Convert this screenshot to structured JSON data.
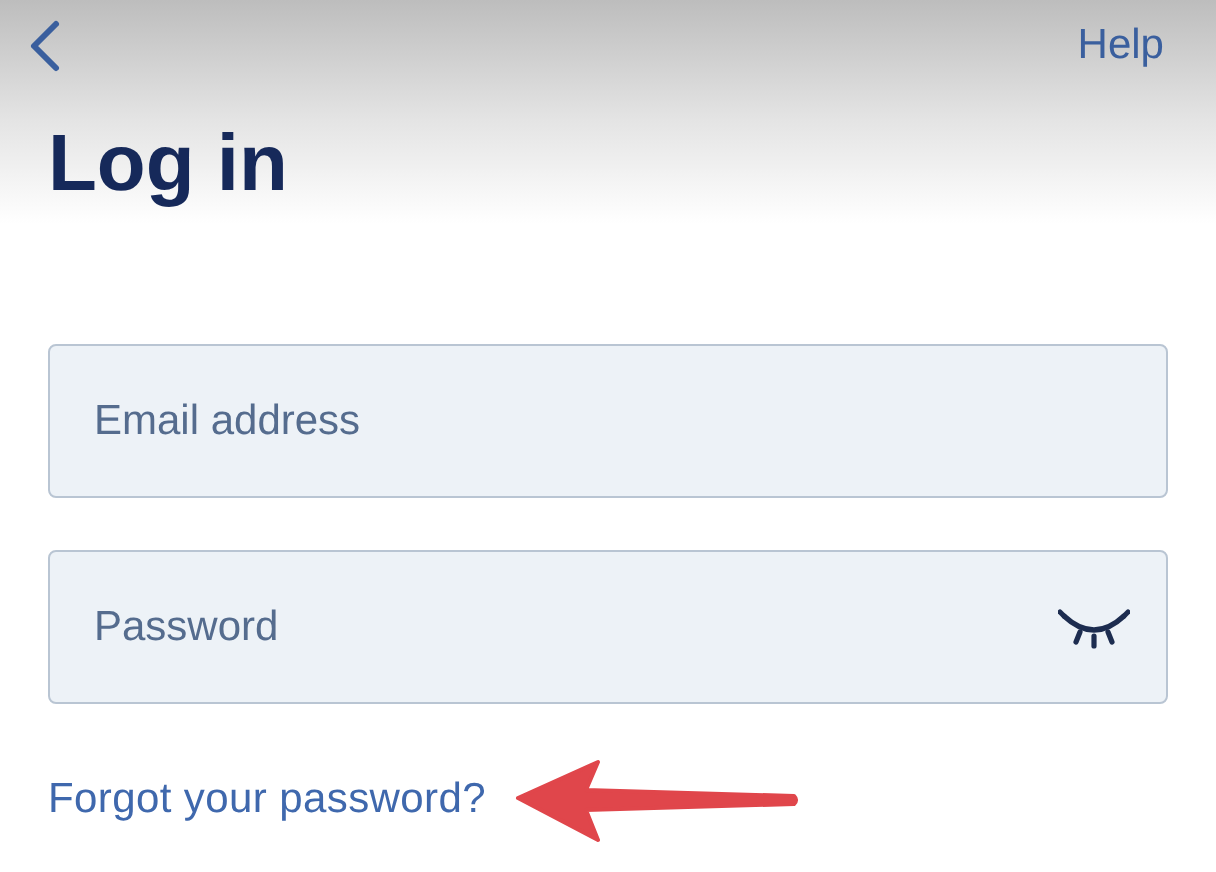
{
  "top_bar": {
    "help": "Help"
  },
  "title": "Log in",
  "fields": [
    {
      "kind": "email",
      "placeholder": "Email address"
    },
    {
      "kind": "password",
      "placeholder": "Password",
      "revealed": false
    }
  ],
  "forgot_link": "Forgot your password?"
}
